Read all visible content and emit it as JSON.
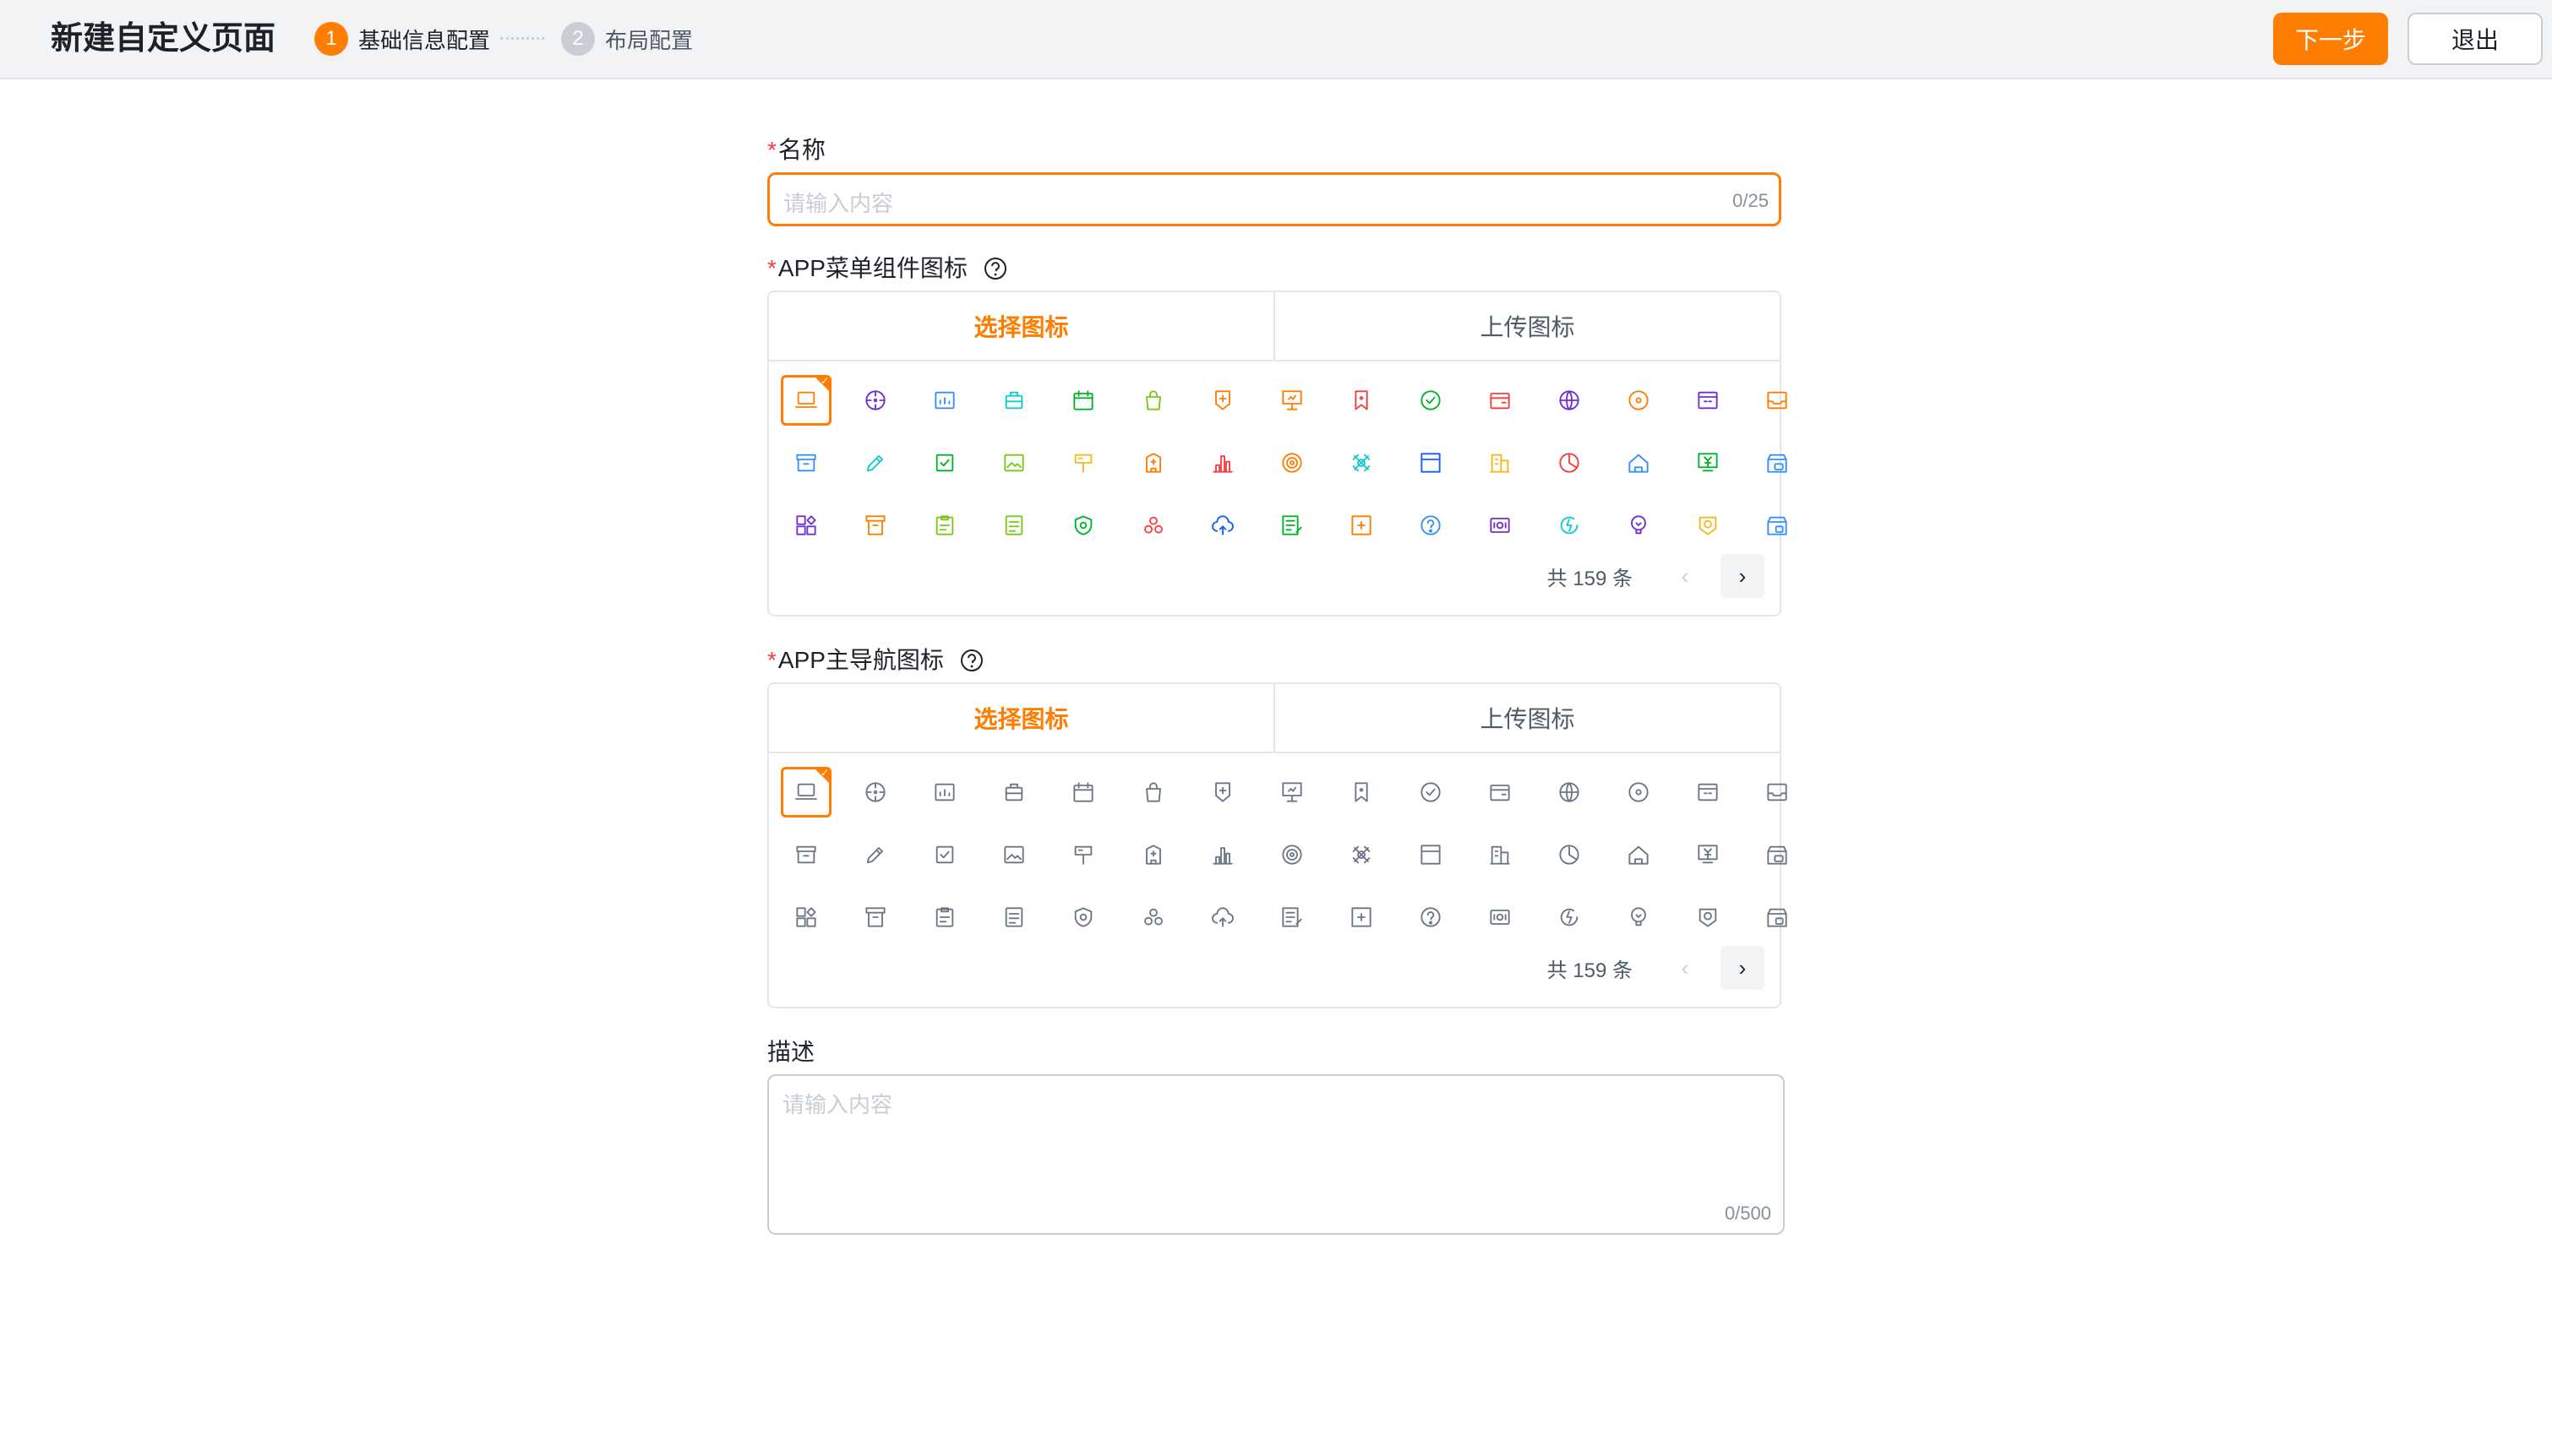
{
  "header": {
    "title": "新建自定义页面",
    "steps": [
      {
        "num": "1",
        "label": "基础信息配置"
      },
      {
        "num": "2",
        "label": "布局配置"
      }
    ],
    "next_label": "下一步",
    "exit_label": "退出"
  },
  "form": {
    "name": {
      "required_mark": "*",
      "label": "名称",
      "placeholder": "请输入内容",
      "counter": "0/25"
    },
    "menu_icon": {
      "required_mark": "*",
      "label": "APP菜单组件图标",
      "tabs": [
        "选择图标",
        "上传图标"
      ],
      "pager_total": "共 159 条",
      "prev": "‹",
      "next": "›"
    },
    "nav_icon": {
      "required_mark": "*",
      "label": "APP主导航图标",
      "tabs": [
        "选择图标",
        "上传图标"
      ],
      "pager_total": "共 159 条",
      "prev": "‹",
      "next": "›"
    },
    "description": {
      "label": "描述",
      "placeholder": "请输入内容",
      "counter": "0/500"
    }
  },
  "icons": [
    {
      "name": "laptop-icon",
      "color": "#ff7d00"
    },
    {
      "name": "crosshair-icon",
      "color": "#722ed1"
    },
    {
      "name": "chart-board-icon",
      "color": "#3491fa"
    },
    {
      "name": "briefcase-icon",
      "color": "#14c9c9"
    },
    {
      "name": "calendar-icon",
      "color": "#00b42a"
    },
    {
      "name": "shopping-bag-icon",
      "color": "#7bc616"
    },
    {
      "name": "badge-icon",
      "color": "#ff7d00"
    },
    {
      "name": "presentation-icon",
      "color": "#ff7d00"
    },
    {
      "name": "bookmark-icon",
      "color": "#f53f3f"
    },
    {
      "name": "check-circle-icon",
      "color": "#00b42a"
    },
    {
      "name": "wallet-icon",
      "color": "#f53f3f"
    },
    {
      "name": "globe-icon",
      "color": "#722ed1"
    },
    {
      "name": "disc-icon",
      "color": "#ff7d00"
    },
    {
      "name": "window-icon",
      "color": "#722ed1"
    },
    {
      "name": "inbox-icon",
      "color": "#ff7d00"
    },
    {
      "name": "archive-icon",
      "color": "#3491fa"
    },
    {
      "name": "pencil-icon",
      "color": "#14c9c9"
    },
    {
      "name": "checkbox-icon",
      "color": "#00b42a"
    },
    {
      "name": "image-icon",
      "color": "#7bc616"
    },
    {
      "name": "signpost-icon",
      "color": "#f7ba1e"
    },
    {
      "name": "building-icon",
      "color": "#ff7d00"
    },
    {
      "name": "bar-chart-icon",
      "color": "#f53f3f"
    },
    {
      "name": "target-icon",
      "color": "#ff7d00"
    },
    {
      "name": "cross-band-icon",
      "color": "#14c9c9"
    },
    {
      "name": "layout-icon",
      "color": "#165dff"
    },
    {
      "name": "office-icon",
      "color": "#f7ba1e"
    },
    {
      "name": "pie-clock-icon",
      "color": "#f53f3f"
    },
    {
      "name": "home-icon",
      "color": "#3491fa"
    },
    {
      "name": "yen-board-icon",
      "color": "#00b42a"
    },
    {
      "name": "store-icon",
      "color": "#3491fa"
    },
    {
      "name": "apps-icon",
      "color": "#722ed1"
    },
    {
      "name": "trash-box-icon",
      "color": "#ff7d00"
    },
    {
      "name": "clipboard-icon",
      "color": "#7bc616"
    },
    {
      "name": "notepad-icon",
      "color": "#7bc616"
    },
    {
      "name": "shield-icon",
      "color": "#00b42a"
    },
    {
      "name": "cluster-icon",
      "color": "#f53f3f"
    },
    {
      "name": "cloud-upload-icon",
      "color": "#165dff"
    },
    {
      "name": "document-edit-icon",
      "color": "#00b42a"
    },
    {
      "name": "first-aid-icon",
      "color": "#ff7d00"
    },
    {
      "name": "question-icon",
      "color": "#3491fa"
    },
    {
      "name": "radio-icon",
      "color": "#722ed1"
    },
    {
      "name": "energy-icon",
      "color": "#14c9c9"
    },
    {
      "name": "bulb-icon",
      "color": "#722ed1"
    },
    {
      "name": "camera-icon",
      "color": "#f7ba1e"
    },
    {
      "name": "shop-icon",
      "color": "#3491fa"
    }
  ],
  "gray_color": "#6b7785",
  "accent_color": "#ff7d00"
}
